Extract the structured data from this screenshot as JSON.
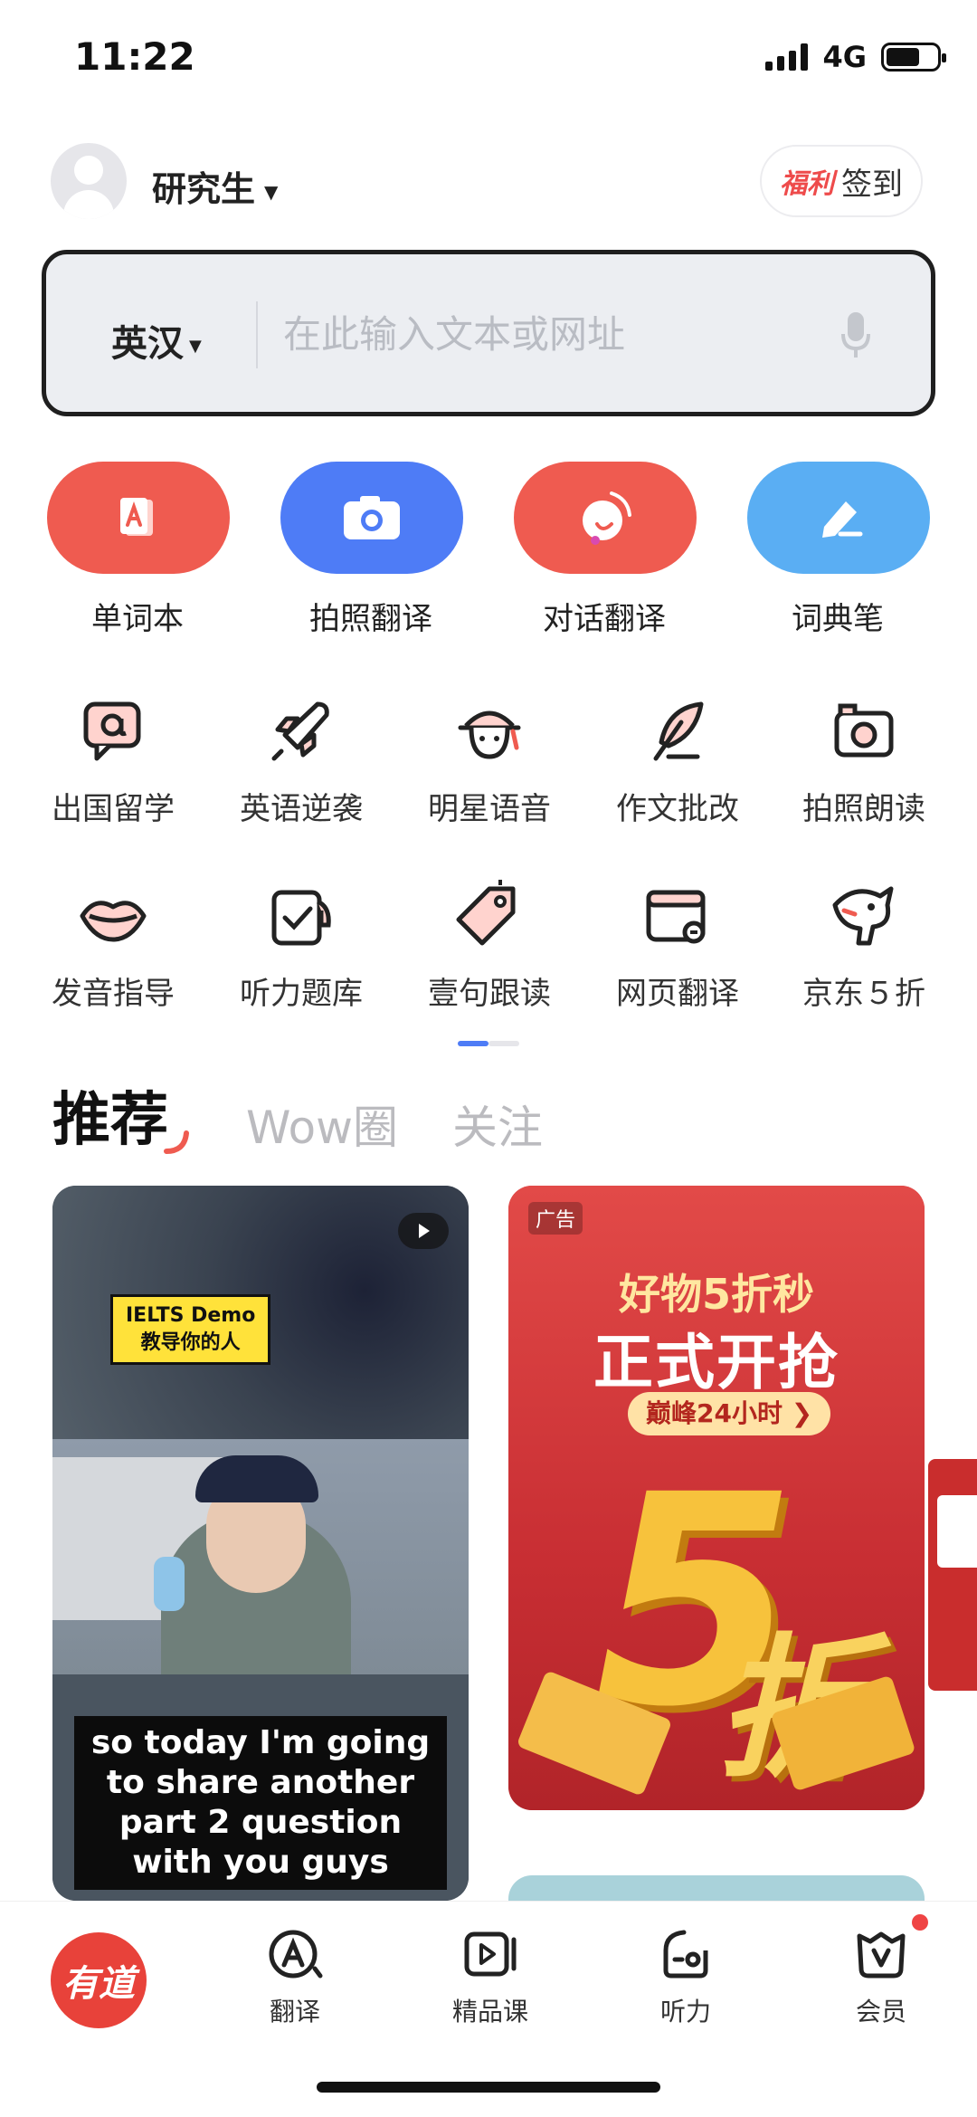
{
  "status_bar": {
    "time": "11:22",
    "network": "4G"
  },
  "header": {
    "grade": "研究生",
    "signin_badge": "福利",
    "signin_label": "签到"
  },
  "search": {
    "lang": "英汉",
    "placeholder": "在此输入文本或网址"
  },
  "main_tools": [
    {
      "label": "单词本",
      "color": "#ef5b50",
      "icon": "wordbook-icon"
    },
    {
      "label": "拍照翻译",
      "color": "#4e7cf6",
      "icon": "camera-icon"
    },
    {
      "label": "对话翻译",
      "color": "#ef5b50",
      "icon": "dialog-icon"
    },
    {
      "label": "词典笔",
      "color": "#5aaef3",
      "icon": "pen-icon"
    }
  ],
  "grid_row1": [
    {
      "label": "出国留学",
      "icon": "study-abroad-icon"
    },
    {
      "label": "英语逆袭",
      "icon": "rocket-icon"
    },
    {
      "label": "明星语音",
      "icon": "star-voice-icon"
    },
    {
      "label": "作文批改",
      "icon": "feather-icon"
    },
    {
      "label": "拍照朗读",
      "icon": "camera-read-icon"
    }
  ],
  "grid_row2": [
    {
      "label": "发音指导",
      "icon": "lips-icon"
    },
    {
      "label": "听力题库",
      "icon": "listening-bank-icon"
    },
    {
      "label": "壹句跟读",
      "icon": "tag-icon"
    },
    {
      "label": "网页翻译",
      "icon": "web-translate-icon"
    },
    {
      "label": "京东５折",
      "icon": "jd-dog-icon"
    }
  ],
  "feed_tabs": {
    "recommend": "推荐",
    "wow": "Wow圈",
    "follow": "关注"
  },
  "video_card": {
    "tag_line1": "IELTS Demo",
    "tag_line2": "教导你的人",
    "caption": "so today I'm going to share another part 2 question with you guys"
  },
  "ad_card": {
    "badge": "广告",
    "title1": "好物5折秒",
    "title2": "正式开抢",
    "pill": "巅峰24小时",
    "big_number": "5",
    "big_char": "折"
  },
  "bottom_nav": {
    "logo": "有道",
    "items": [
      {
        "label": "翻译",
        "icon": "translate-icon"
      },
      {
        "label": "精品课",
        "icon": "course-icon"
      },
      {
        "label": "听力",
        "icon": "listening-icon"
      },
      {
        "label": "会员",
        "icon": "vip-icon"
      }
    ]
  }
}
